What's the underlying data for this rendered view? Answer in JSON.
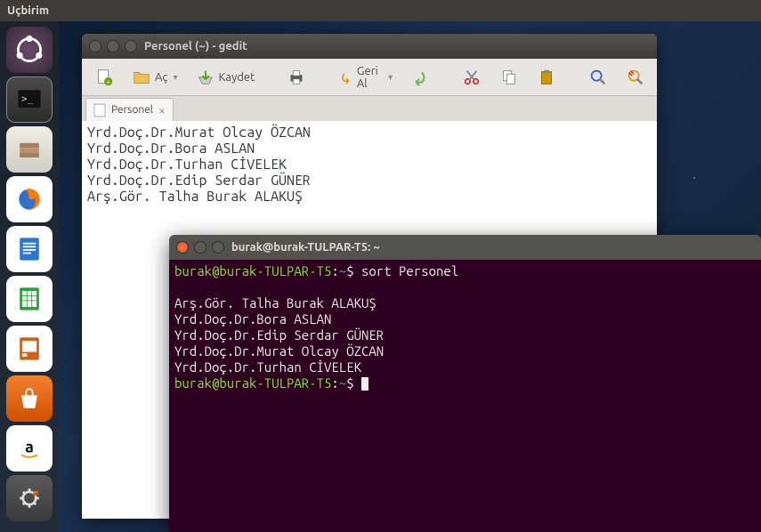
{
  "top_panel": {
    "title": "Uçbirim"
  },
  "launcher": {
    "items": [
      {
        "name": "ubuntu-dash",
        "label": "Dash"
      },
      {
        "name": "terminal",
        "label": "Terminal"
      },
      {
        "name": "files",
        "label": "Files"
      },
      {
        "name": "firefox",
        "label": "Firefox"
      },
      {
        "name": "writer",
        "label": "LibreOffice Writer"
      },
      {
        "name": "calc",
        "label": "LibreOffice Calc"
      },
      {
        "name": "impress",
        "label": "LibreOffice Impress"
      },
      {
        "name": "software-center",
        "label": "Ubuntu Software"
      },
      {
        "name": "amazon",
        "label": "Amazon"
      },
      {
        "name": "system-settings",
        "label": "System Settings"
      }
    ]
  },
  "gedit": {
    "title": "Personel (~) - gedit",
    "toolbar": {
      "open": "Aç",
      "save": "Kaydet",
      "undo": "Geri Al"
    },
    "tab": {
      "label": "Personel"
    },
    "lines": [
      "Yrd.Doç.Dr.Murat Olcay ÖZCAN",
      "Yrd.Doç.Dr.Bora ASLAN",
      "Yrd.Doç.Dr.Turhan CİVELEK",
      "Yrd.Doç.Dr.Edip Serdar GÜNER",
      "Arş.Gör. Talha Burak ALAKUŞ"
    ]
  },
  "terminal": {
    "title": "burak@burak-TULPAR-T5: ~",
    "prompt_user_host": "burak@burak-TULPAR-T5",
    "prompt_sep": ":",
    "prompt_path": "~",
    "prompt_end": "$ ",
    "command": "sort Personel",
    "output": [
      "",
      "Arş.Gör. Talha Burak ALAKUŞ",
      "Yrd.Doç.Dr.Bora ASLAN",
      "Yrd.Doç.Dr.Edip Serdar GÜNER",
      "Yrd.Doç.Dr.Murat Olcay ÖZCAN",
      "Yrd.Doç.Dr.Turhan CİVELEK"
    ]
  }
}
